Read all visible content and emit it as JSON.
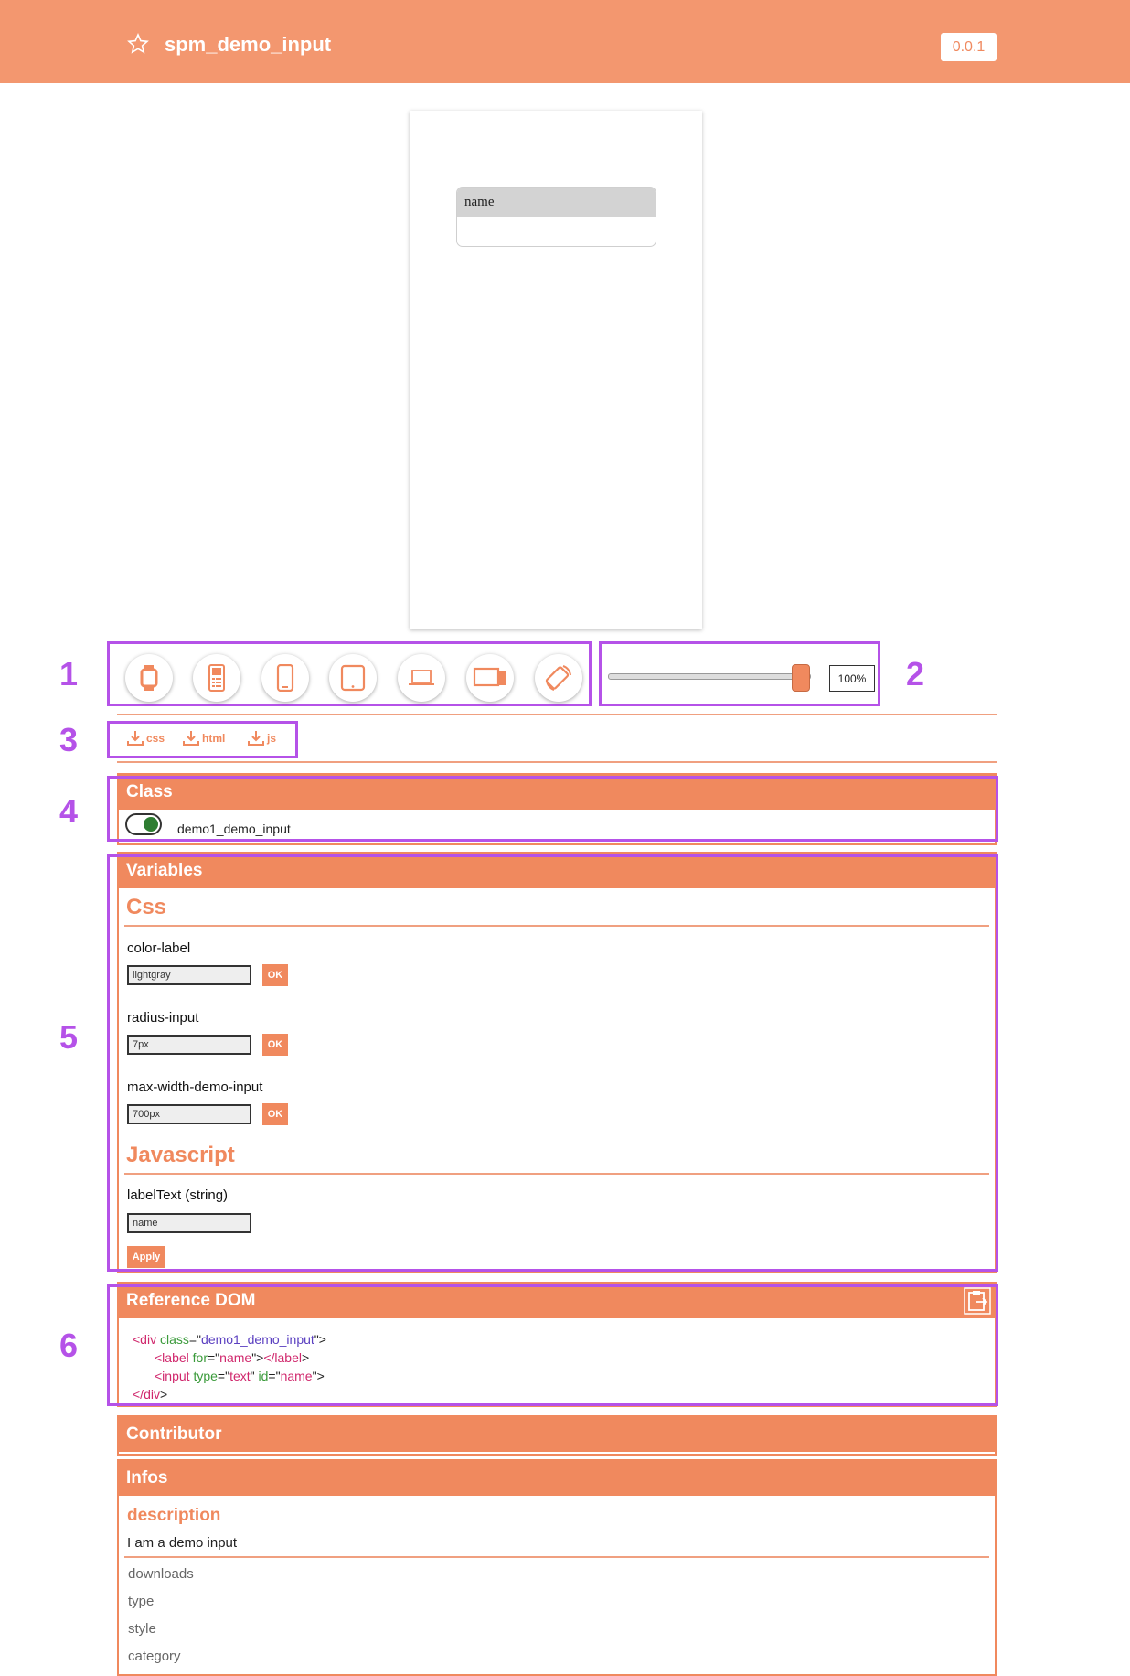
{
  "header": {
    "title": "spm_demo_input",
    "version": "0.0.1",
    "star_icon": "star-outline-icon"
  },
  "preview": {
    "label_text": "name",
    "input_value": ""
  },
  "annotations": {
    "n1": "1",
    "n2": "2",
    "n3": "3",
    "n4": "4",
    "n5": "5",
    "n6": "6"
  },
  "devices": [
    "watch-icon",
    "feature-phone-icon",
    "smartphone-icon",
    "tablet-icon",
    "laptop-icon",
    "desktop-icon",
    "rotate-icon"
  ],
  "zoom": {
    "value": "100%",
    "slider_level": 1.0
  },
  "downloads": {
    "css": "css",
    "html": "html",
    "js": "js"
  },
  "class_panel": {
    "title": "Class",
    "class_name": "demo1_demo_input",
    "enabled": true
  },
  "variables": {
    "title": "Variables",
    "css_heading": "Css",
    "css_vars": [
      {
        "name": "color-label",
        "value": "lightgray",
        "button": "OK"
      },
      {
        "name": "radius-input",
        "value": "7px",
        "button": "OK"
      },
      {
        "name": "max-width-demo-input",
        "value": "700px",
        "button": "OK"
      }
    ],
    "js_heading": "Javascript",
    "js_vars": [
      {
        "name": "labelText (string)",
        "value": "name"
      }
    ],
    "apply": "Apply"
  },
  "reference_dom": {
    "title": "Reference DOM",
    "code": {
      "line1_open": "<div",
      "line1_attr": "class",
      "line1_val": "demo1_demo_input",
      "line2_open": "<label",
      "line2_attr": "for",
      "line2_val": "name",
      "line2_close": "</label",
      "line3_open": "<input",
      "line3_attr1": "type",
      "line3_val1": "text",
      "line3_attr2": "id",
      "line3_val2": "name",
      "line4_close": "</div"
    }
  },
  "contributor": {
    "title": "Contributor"
  },
  "infos": {
    "title": "Infos",
    "description_heading": "description",
    "description": "I am a demo input",
    "fields": [
      "downloads",
      "type",
      "style",
      "category"
    ]
  },
  "colors": {
    "accent": "#f0895e",
    "header": "#f3976f",
    "annotation": "#b552e8"
  }
}
